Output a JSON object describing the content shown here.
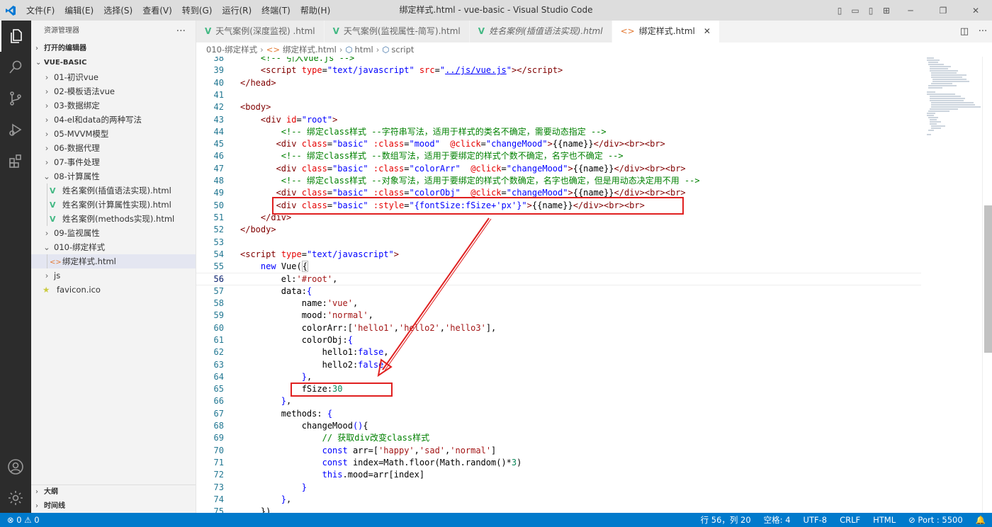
{
  "window": {
    "title": "绑定样式.html - vue-basic - Visual Studio Code",
    "menu": [
      "文件(F)",
      "编辑(E)",
      "选择(S)",
      "查看(V)",
      "转到(G)",
      "运行(R)",
      "终端(T)",
      "帮助(H)"
    ]
  },
  "sidebar": {
    "header": "资源管理器",
    "open_editors": "打开的编辑器",
    "workspace": "VUE-BASIC",
    "tree": [
      {
        "label": "01-初识vue",
        "kind": "folder",
        "open": false,
        "depth": 0
      },
      {
        "label": "02-模板语法vue",
        "kind": "folder",
        "open": false,
        "depth": 0
      },
      {
        "label": "03-数据绑定",
        "kind": "folder",
        "open": false,
        "depth": 0
      },
      {
        "label": "04-el和data的两种写法",
        "kind": "folder",
        "open": false,
        "depth": 0
      },
      {
        "label": "05-MVVM模型",
        "kind": "folder",
        "open": false,
        "depth": 0
      },
      {
        "label": "06-数据代理",
        "kind": "folder",
        "open": false,
        "depth": 0
      },
      {
        "label": "07-事件处理",
        "kind": "folder",
        "open": false,
        "depth": 0
      },
      {
        "label": "08-计算属性",
        "kind": "folder",
        "open": true,
        "depth": 0
      },
      {
        "label": "姓名案例(插值语法实现).html",
        "kind": "vue",
        "depth": 1
      },
      {
        "label": "姓名案例(计算属性实现).html",
        "kind": "vue",
        "depth": 1
      },
      {
        "label": "姓名案例(methods实现).html",
        "kind": "vue",
        "depth": 1
      },
      {
        "label": "09-监视属性",
        "kind": "folder",
        "open": false,
        "depth": 0
      },
      {
        "label": "010-绑定样式",
        "kind": "folder",
        "open": true,
        "depth": 0
      },
      {
        "label": "绑定样式.html",
        "kind": "html",
        "depth": 1,
        "selected": true
      },
      {
        "label": "js",
        "kind": "folder",
        "open": false,
        "depth": 0
      },
      {
        "label": "favicon.ico",
        "kind": "star",
        "depth": 0
      }
    ],
    "outline": "大纲",
    "timeline": "时间线"
  },
  "tabs": [
    {
      "label": "天气案例(深度监视) .html",
      "kind": "vue",
      "italic": false,
      "active": false
    },
    {
      "label": "天气案例(监视属性-简写).html",
      "kind": "vue",
      "italic": false,
      "active": false
    },
    {
      "label": "姓名案例(插值语法实现).html",
      "kind": "vue",
      "italic": true,
      "active": false
    },
    {
      "label": "绑定样式.html",
      "kind": "html",
      "italic": false,
      "active": true
    }
  ],
  "breadcrumb": [
    "010-绑定样式",
    "绑定样式.html",
    "html",
    "script"
  ],
  "editor": {
    "lines": [
      {
        "n": "38",
        "html": "    <span class='t-cm'>&lt;!-- 引入vue.js --&gt;</span>"
      },
      {
        "n": "39",
        "html": "    <span class='t-tag'>&lt;script</span> <span class='t-attr'>type</span>=<span class='t-str'>\"text/javascript\"</span> <span class='t-attr'>src</span>=<span class='t-str'>\"<u>../js/vue.js</u>\"</span><span class='t-tag'>&gt;&lt;/script&gt;</span>"
      },
      {
        "n": "40",
        "html": "<span class='t-tag'>&lt;/head&gt;</span>"
      },
      {
        "n": "41",
        "html": ""
      },
      {
        "n": "42",
        "html": "<span class='t-tag'>&lt;body&gt;</span>"
      },
      {
        "n": "43",
        "html": "    <span class='t-tag'>&lt;div</span> <span class='t-attr'>id</span>=<span class='t-str'>\"root\"</span><span class='t-tag'>&gt;</span>"
      },
      {
        "n": "44",
        "html": "        <span class='t-cm'>&lt;!-- 绑定class样式 --字符串写法，适用于样式的类名不确定，需要动态指定 --&gt;</span>"
      },
      {
        "n": "45",
        "html": "       <span class='t-tag'>&lt;div</span> <span class='t-attr'>class</span>=<span class='t-str'>\"basic\"</span> <span class='t-attr'>:class</span>=<span class='t-str'>\"mood\"</span>  <span class='t-attr'>@click</span>=<span class='t-str'>\"changeMood\"</span><span class='t-tag'>&gt;</span>{{name}}<span class='t-tag'>&lt;/div&gt;&lt;br&gt;&lt;br&gt;</span>"
      },
      {
        "n": "46",
        "html": "        <span class='t-cm'>&lt;!-- 绑定class样式 --数组写法，适用于要绑定的样式个数不确定，名字也不确定 --&gt;</span>"
      },
      {
        "n": "47",
        "html": "       <span class='t-tag'>&lt;div</span> <span class='t-attr'>class</span>=<span class='t-str'>\"basic\"</span> <span class='t-attr'>:class</span>=<span class='t-str'>\"colorArr\"</span>  <span class='t-attr'>@click</span>=<span class='t-str'>\"changeMood\"</span><span class='t-tag'>&gt;</span>{{name}}<span class='t-tag'>&lt;/div&gt;&lt;br&gt;&lt;br&gt;</span>"
      },
      {
        "n": "48",
        "html": "        <span class='t-cm'>&lt;!-- 绑定class样式 --对象写法，适用于要绑定的样式个数确定，名字也确定，但是用动态决定用不用 --&gt;</span>"
      },
      {
        "n": "49",
        "html": "       <span class='t-tag'>&lt;div</span> <span class='t-attr'>class</span>=<span class='t-str'>\"basic\"</span> <span class='t-attr'>:class</span>=<span class='t-str'>\"colorObj\"</span>  <span class='t-attr'>@click</span>=<span class='t-str'>\"changeMood\"</span><span class='t-tag'>&gt;</span>{{name}}<span class='t-tag'>&lt;/div&gt;&lt;br&gt;&lt;br&gt;</span>"
      },
      {
        "n": "50",
        "html": "       <span class='t-tag'>&lt;div</span> <span class='t-attr'>class</span>=<span class='t-str'>\"basic\"</span> <span class='t-attr'>:style</span>=<span class='t-str'>\"{fontSize:fSize+'px'}\"</span><span class='t-tag'>&gt;</span>{{name}}<span class='t-tag'>&lt;/div&gt;&lt;br&gt;&lt;br&gt;</span>"
      },
      {
        "n": "51",
        "html": "    <span class='t-tag'>&lt;/div&gt;</span>"
      },
      {
        "n": "52",
        "html": "<span class='t-tag'>&lt;/body&gt;</span>"
      },
      {
        "n": "53",
        "html": ""
      },
      {
        "n": "54",
        "html": "<span class='t-tag'>&lt;script</span> <span class='t-attr'>type</span>=<span class='t-str'>\"text/javascript\"</span><span class='t-tag'>&gt;</span>"
      },
      {
        "n": "55",
        "html": "    <span class='t-kw'>new</span> Vue(<span style='border:1px solid #bbb'>{</span>"
      },
      {
        "n": "56",
        "html": "        el:<span class='t-str2'>'#root'</span>,",
        "cur": true
      },
      {
        "n": "57",
        "html": "        data:<span class='t-kw'>{</span>"
      },
      {
        "n": "58",
        "html": "            name:<span class='t-str2'>'vue'</span>,"
      },
      {
        "n": "59",
        "html": "            mood:<span class='t-str2'>'normal'</span>,"
      },
      {
        "n": "60",
        "html": "            colorArr:[<span class='t-str2'>'hello1'</span>,<span class='t-str2'>'hello2'</span>,<span class='t-str2'>'hello3'</span>],"
      },
      {
        "n": "61",
        "html": "            colorObj:<span class='t-kw'>{</span>"
      },
      {
        "n": "62",
        "html": "                hello1:<span class='t-kw'>false</span>,"
      },
      {
        "n": "63",
        "html": "                hello2:<span class='t-kw'>false</span>"
      },
      {
        "n": "64",
        "html": "            <span class='t-kw'>}</span>,"
      },
      {
        "n": "65",
        "html": "            fSize:<span class='t-num'>30</span>"
      },
      {
        "n": "66",
        "html": "        <span class='t-kw'>}</span>,"
      },
      {
        "n": "67",
        "html": "        methods: <span class='t-kw'>{</span>"
      },
      {
        "n": "68",
        "html": "            changeMood<span class='t-kw'>()</span>{"
      },
      {
        "n": "69",
        "html": "                <span class='t-cm'>// 获取div改变class样式</span>"
      },
      {
        "n": "70",
        "html": "                <span class='t-kw'>const</span> arr=[<span class='t-str2'>'happy'</span>,<span class='t-str2'>'sad'</span>,<span class='t-str2'>'normal'</span>]"
      },
      {
        "n": "71",
        "html": "                <span class='t-kw'>const</span> index=Math.floor(Math.random()*<span class='t-num'>3</span>)"
      },
      {
        "n": "72",
        "html": "                <span class='t-kw'>this</span>.mood=arr[index]"
      },
      {
        "n": "73",
        "html": "            <span class='t-kw'>}</span>"
      },
      {
        "n": "74",
        "html": "        <span class='t-kw'>}</span>,"
      },
      {
        "n": "75",
        "html": "    })"
      }
    ]
  },
  "statusbar": {
    "problems": "⊗ 0 ⚠ 0",
    "position": "行 56，列 20",
    "spaces": "空格: 4",
    "encoding": "UTF-8",
    "eol": "CRLF",
    "language": "HTML",
    "port": "⊘ Port : 5500"
  }
}
